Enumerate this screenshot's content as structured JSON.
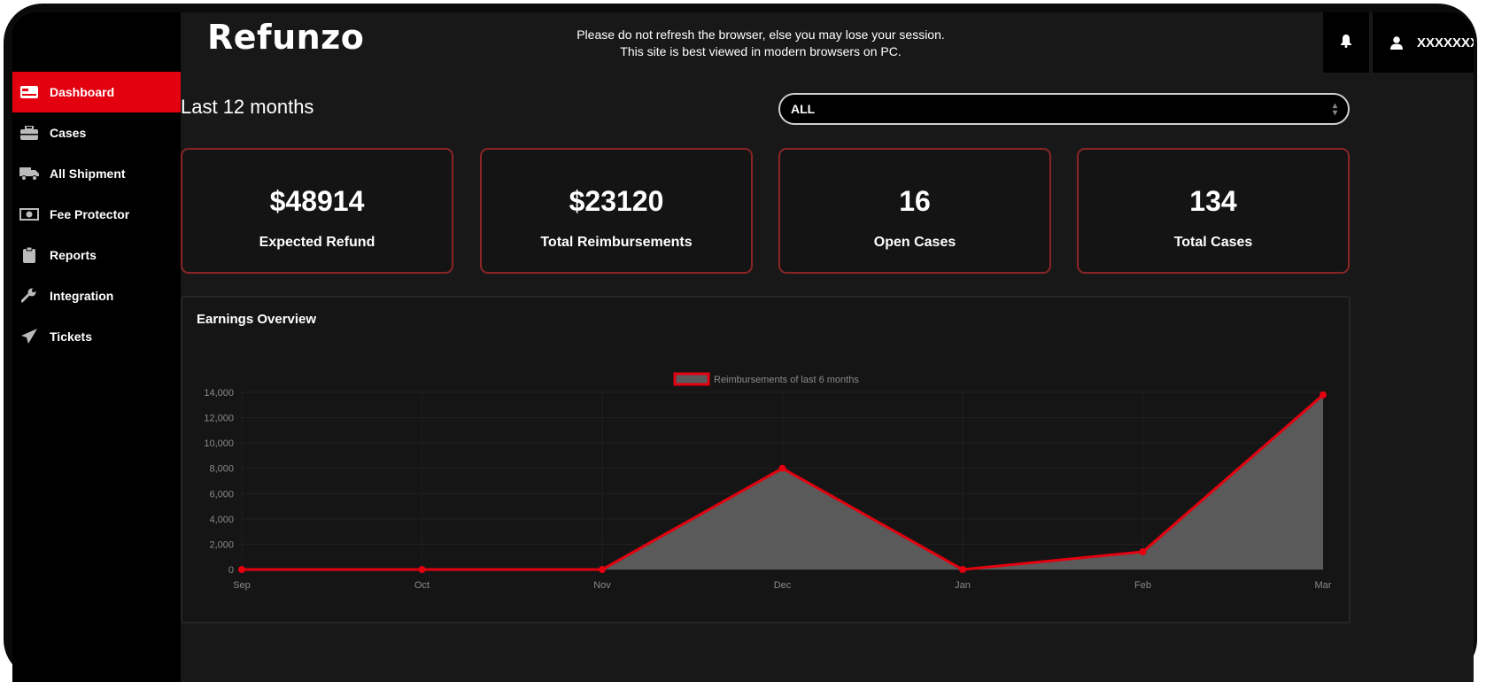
{
  "app": {
    "logo": "Refunzo"
  },
  "header": {
    "notice_line1": "Please do not refresh the browser, else you may lose your session.",
    "notice_line2": "This site is best viewed in modern browsers on PC.",
    "user_name": "XXXXXXX"
  },
  "sidebar": {
    "items": [
      {
        "label": "Dashboard",
        "icon": "card-icon",
        "active": true
      },
      {
        "label": "Cases",
        "icon": "briefcase-icon",
        "active": false
      },
      {
        "label": "All Shipment",
        "icon": "truck-icon",
        "active": false
      },
      {
        "label": "Fee Protector",
        "icon": "money-icon",
        "active": false
      },
      {
        "label": "Reports",
        "icon": "clipboard-icon",
        "active": false
      },
      {
        "label": "Integration",
        "icon": "wrench-icon",
        "active": false
      },
      {
        "label": "Tickets",
        "icon": "paper-plane-icon",
        "active": false
      }
    ]
  },
  "main": {
    "title": "Last 12 months",
    "filter": {
      "selected": "ALL"
    },
    "cards": [
      {
        "value": "$48914",
        "label": "Expected Refund"
      },
      {
        "value": "$23120",
        "label": "Total Reimbursements"
      },
      {
        "value": "16",
        "label": "Open Cases"
      },
      {
        "value": "134",
        "label": "Total Cases"
      }
    ],
    "panel_title": "Earnings Overview"
  },
  "colors": {
    "accent": "#e3000f",
    "card_border": "#8a2525",
    "area_fill": "#5a5a5a",
    "line": "#e3000f"
  },
  "chart_data": {
    "type": "area",
    "categories": [
      "Sep",
      "Oct",
      "Nov",
      "Dec",
      "Jan",
      "Feb",
      "Mar"
    ],
    "series": [
      {
        "name": "Reimbursements of last 6 months",
        "values": [
          0,
          0,
          0,
          8000,
          0,
          1400,
          13800
        ]
      }
    ],
    "ylim": [
      0,
      14000
    ],
    "yticks": [
      0,
      2000,
      4000,
      6000,
      8000,
      10000,
      12000,
      14000
    ],
    "ytick_labels": [
      "0",
      "2,000",
      "4,000",
      "6,000",
      "8,000",
      "10,000",
      "12,000",
      "14,000"
    ],
    "legend": "top-center",
    "grid": true
  }
}
